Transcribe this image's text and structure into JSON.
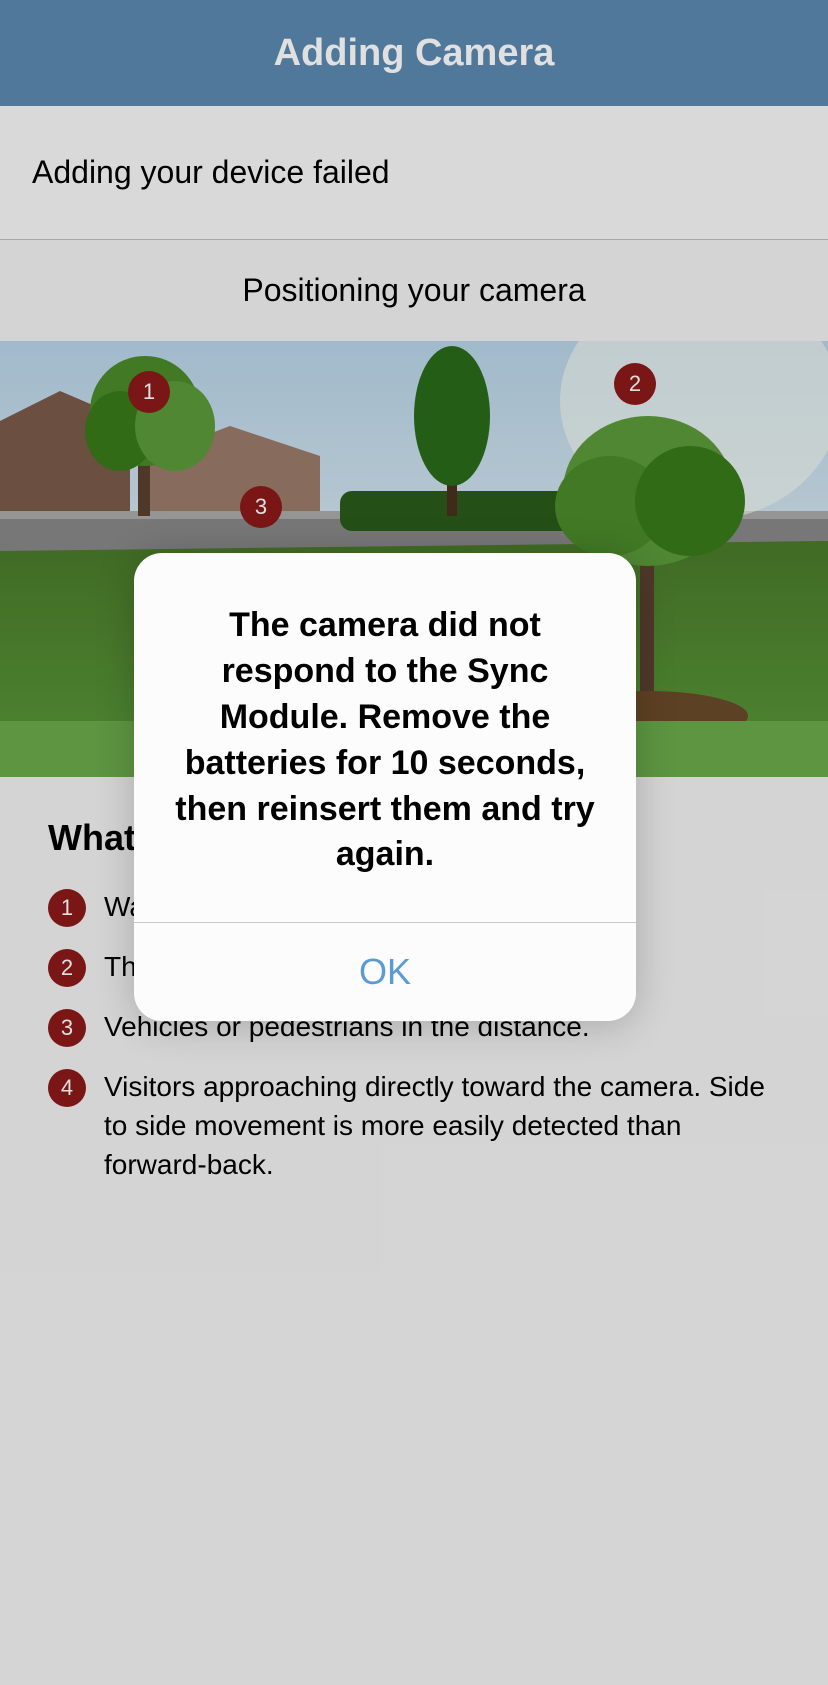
{
  "header": {
    "title": "Adding Camera"
  },
  "status": {
    "text": "Adding your device failed"
  },
  "subtitle": "Positioning your camera",
  "image_markers": [
    "1",
    "2",
    "3"
  ],
  "avoid": {
    "title": "What to avoid",
    "items": [
      {
        "badge": "1",
        "text": "Waving trees or swaying branches."
      },
      {
        "badge": "2",
        "text": "The sun or bright lights."
      },
      {
        "badge": "3",
        "text": "Vehicles or pedestrians in the distance."
      },
      {
        "badge": "4",
        "text": "Visitors approaching directly toward the camera. Side to side movement is more easily detected than forward-back."
      }
    ]
  },
  "dialog": {
    "message": "The camera did not respond to the Sync Module. Remove the batteries for 10 seconds, then reinsert them and try again.",
    "ok_label": "OK"
  }
}
